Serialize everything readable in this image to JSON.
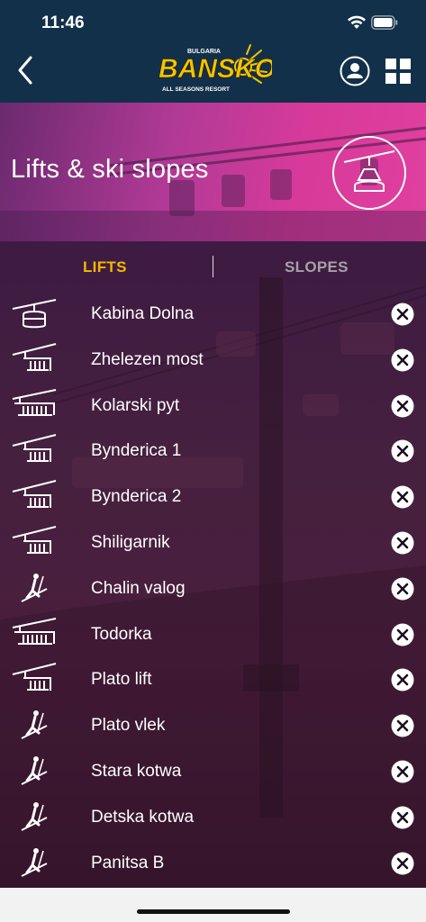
{
  "status_bar": {
    "time": "11:46"
  },
  "header": {
    "logo_top": "BULGARIA",
    "logo_main": "BANSKO",
    "logo_sub": "ALL SEASONS RESORT"
  },
  "hero": {
    "title": "Lifts & ski slopes",
    "emblem_icon": "gondola-icon"
  },
  "tabs": [
    {
      "label": "LIFTS",
      "active": true,
      "color": "#f4b800"
    },
    {
      "label": "SLOPES",
      "active": false,
      "color": "#a8a0a8"
    }
  ],
  "lifts": [
    {
      "name": "Kabina Dolna",
      "icon": "gondola-icon",
      "status": "closed"
    },
    {
      "name": "Zhelezen most",
      "icon": "chairlift-4-icon",
      "status": "closed"
    },
    {
      "name": "Kolarski pyt",
      "icon": "chairlift-6-icon",
      "status": "closed"
    },
    {
      "name": "Bynderica 1",
      "icon": "chairlift-4-icon",
      "status": "closed"
    },
    {
      "name": "Bynderica 2",
      "icon": "chairlift-4-icon",
      "status": "closed"
    },
    {
      "name": "Shiligarnik",
      "icon": "chairlift-4-icon",
      "status": "closed"
    },
    {
      "name": "Chalin valog",
      "icon": "draglift-icon",
      "status": "closed"
    },
    {
      "name": "Todorka",
      "icon": "chairlift-6-icon",
      "status": "closed"
    },
    {
      "name": "Plato lift",
      "icon": "chairlift-4-icon",
      "status": "closed"
    },
    {
      "name": "Plato vlek",
      "icon": "draglift-icon",
      "status": "closed"
    },
    {
      "name": "Stara kotwa",
      "icon": "draglift-icon",
      "status": "closed"
    },
    {
      "name": "Detska kotwa",
      "icon": "draglift-icon",
      "status": "closed"
    },
    {
      "name": "Panitsa B",
      "icon": "draglift-icon",
      "status": "closed"
    }
  ]
}
